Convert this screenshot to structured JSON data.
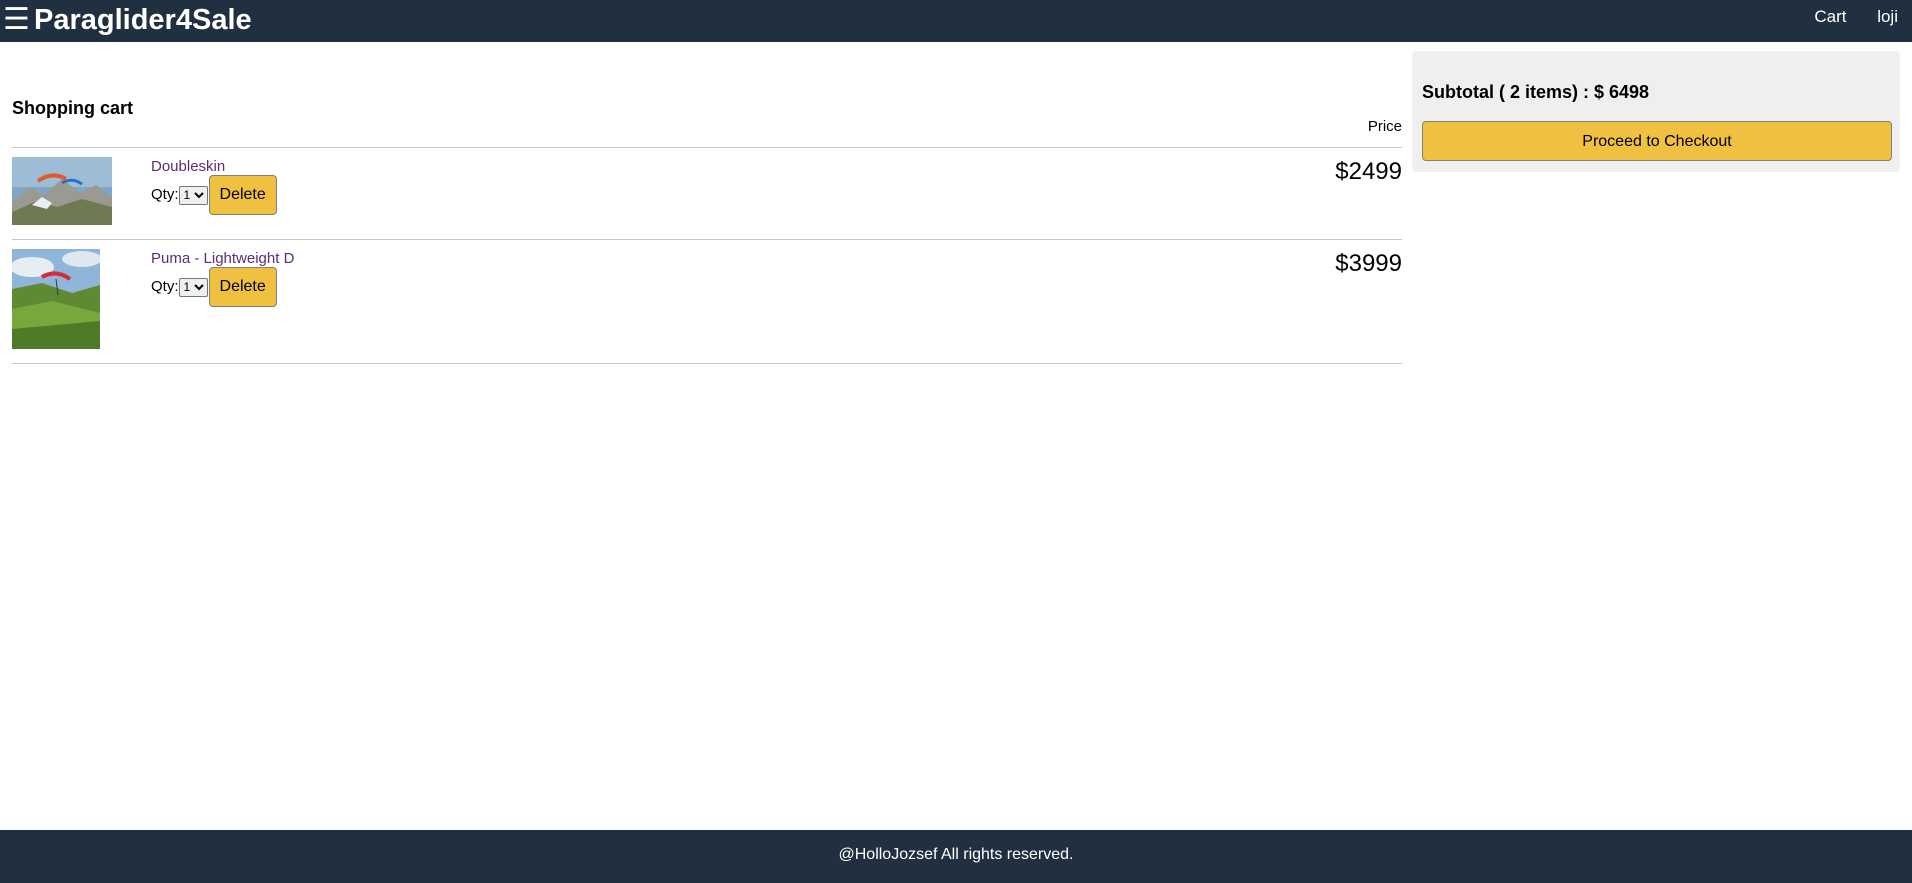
{
  "header": {
    "menu_icon": "hamburger-icon",
    "brand": "Paraglider4Sale",
    "nav": {
      "cart": "Cart",
      "user": "loji"
    }
  },
  "cart": {
    "title": "Shopping cart",
    "price_header": "Price",
    "items": [
      {
        "name": "Doubleskin",
        "qty_label": "Qty:",
        "qty_value": "1",
        "delete_label": "Delete",
        "price": "$2499",
        "image": "paraglider-over-mountains-photo"
      },
      {
        "name": "Puma - Lightweight D",
        "qty_label": "Qty:",
        "qty_value": "1",
        "delete_label": "Delete",
        "price": "$3999",
        "image": "paraglider-over-green-hill-photo"
      }
    ]
  },
  "summary": {
    "subtotal": "Subtotal ( 2 items) : $ 6498",
    "checkout_label": "Proceed to Checkout"
  },
  "footer": {
    "text": "@HolloJozsef All rights reserved."
  },
  "colors": {
    "header_bg": "#203040",
    "button_bg": "#f0c040",
    "summary_bg": "#efefef",
    "link": "#5b2d7a"
  }
}
